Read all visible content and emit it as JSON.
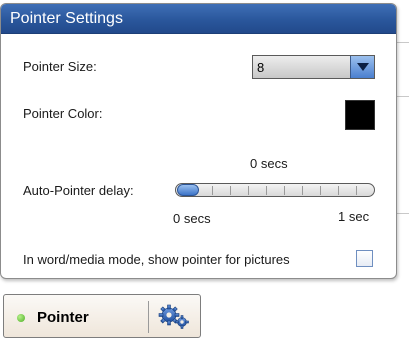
{
  "window": {
    "title": "Pointer Settings"
  },
  "pointer_size": {
    "label": "Pointer Size:",
    "value": "8"
  },
  "pointer_color": {
    "label": "Pointer Color:",
    "color": "#000000"
  },
  "auto_pointer_delay": {
    "label": "Auto-Pointer delay:",
    "current_value": "0 secs",
    "min_label": "0 secs",
    "max_label": "1 sec",
    "level_fraction": 0.0
  },
  "pictures_option": {
    "label": "In word/media mode, show pointer for pictures",
    "checked": false
  },
  "pointer_button": {
    "label": "Pointer",
    "status_color": "#4caf24",
    "icon": "gears-icon"
  },
  "colors": {
    "title_bar": "#2a579c",
    "accent": "#4a7fcf"
  }
}
